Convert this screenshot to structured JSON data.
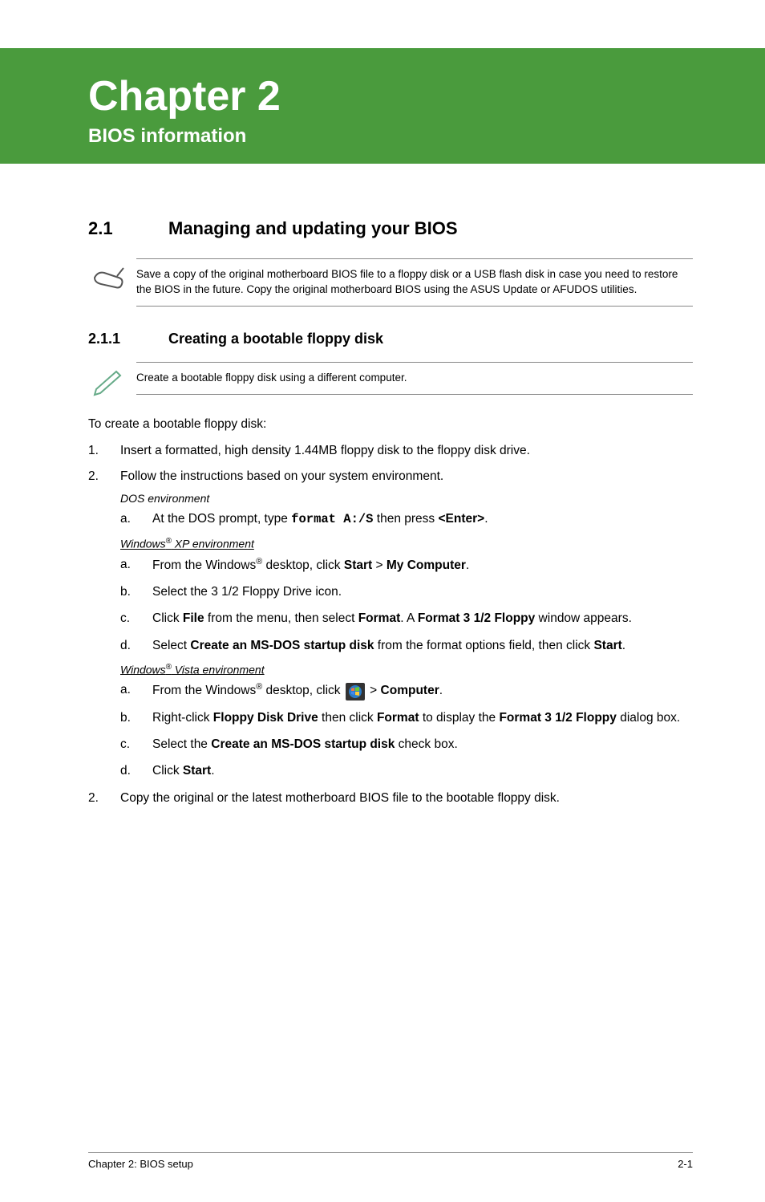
{
  "banner": {
    "chapter_title": "Chapter 2",
    "subtitle": "BIOS information"
  },
  "section": {
    "number": "2.1",
    "title": "Managing and updating your BIOS"
  },
  "note1": {
    "text": "Save a copy of the original motherboard BIOS file to a floppy disk or a USB flash disk in case you need to restore the BIOS in the future. Copy the original motherboard BIOS using the ASUS Update or AFUDOS utilities."
  },
  "subsection": {
    "number": "2.1.1",
    "title": "Creating a bootable floppy disk"
  },
  "note2": {
    "text": "Create a bootable floppy disk using a different computer."
  },
  "intro": "To create a bootable floppy disk:",
  "step1": {
    "num": "1.",
    "text": "Insert a formatted, high density 1.44MB floppy disk to the floppy disk drive."
  },
  "step2": {
    "num": "2.",
    "text": "Follow the instructions based on your system environment."
  },
  "env_dos": "DOS environment",
  "dos_a": {
    "letter": "a.",
    "text_pre": "At the DOS prompt, type ",
    "cmd": "format A:/S",
    "text_mid": " then press ",
    "enter": "<Enter>",
    "text_post": "."
  },
  "env_xp_pre": "Windows",
  "env_xp_sup": "®",
  "env_xp_post": " XP environment",
  "xp_a": {
    "letter": "a.",
    "t1": "From the Windows",
    "sup": "®",
    "t2": " desktop, click ",
    "b1": "Start",
    "t3": " > ",
    "b2": "My Computer",
    "t4": "."
  },
  "xp_b": {
    "letter": "b.",
    "text": "Select the 3 1/2 Floppy Drive icon."
  },
  "xp_c": {
    "letter": "c.",
    "t1": "Click ",
    "b1": "File",
    "t2": " from the menu, then select ",
    "b2": "Format",
    "t3": ". A ",
    "b3": "Format 3 1/2 Floppy",
    "t4": " window appears."
  },
  "xp_d": {
    "letter": "d.",
    "t1": "Select ",
    "b1": "Create an MS-DOS startup disk",
    "t2": " from the format options field, then click ",
    "b2": "Start",
    "t3": "."
  },
  "env_vista_pre": "Windows",
  "env_vista_sup": "®",
  "env_vista_post": " Vista environment",
  "vista_a": {
    "letter": "a.",
    "t1": "From the Windows",
    "sup": "®",
    "t2": " desktop, click ",
    "t3": " > ",
    "b1": "Computer",
    "t4": "."
  },
  "vista_b": {
    "letter": "b.",
    "t1": "Right-click ",
    "b1": "Floppy Disk Drive",
    "t2": " then click ",
    "b2": "Format",
    "t3": " to display the ",
    "b3": "Format 3 1/2 Floppy",
    "t4": " dialog box."
  },
  "vista_c": {
    "letter": "c.",
    "t1": "Select the ",
    "b1": "Create an MS-DOS startup disk",
    "t2": " check box."
  },
  "vista_d": {
    "letter": "d.",
    "t1": "Click ",
    "b1": "Start",
    "t2": "."
  },
  "step2b": {
    "num": "2.",
    "text": "Copy the original or the latest motherboard BIOS file to the bootable floppy disk."
  },
  "footer": {
    "left": "Chapter 2: BIOS setup",
    "right": "2-1"
  }
}
